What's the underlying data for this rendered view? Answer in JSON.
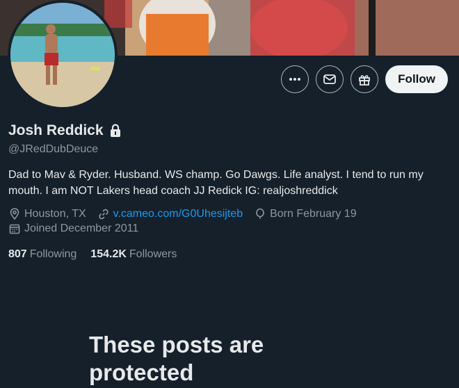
{
  "profile": {
    "display_name": "Josh Reddick",
    "handle": "@JRedDubDeuce",
    "bio": "Dad to Mav & Ryder. Husband. WS champ.  Go Dawgs. Life analyst. I tend to run my mouth. I am NOT Lakers head coach JJ Redick IG: realjoshreddick",
    "location": "Houston, TX",
    "website": "v.cameo.com/G0Uhesijteb",
    "birthday": "Born February 19",
    "joined": "Joined December 2011"
  },
  "stats": {
    "following_count": "807",
    "following_label": "Following",
    "followers_count": "154.2K",
    "followers_label": "Followers"
  },
  "actions": {
    "follow_label": "Follow"
  },
  "protected": {
    "heading": "These posts are protected"
  },
  "colors": {
    "background": "#15202b",
    "text": "#e7e9ea",
    "secondary_text": "#8b98a5",
    "link": "#1d9bf0",
    "follow_button_bg": "#eff3f4"
  }
}
